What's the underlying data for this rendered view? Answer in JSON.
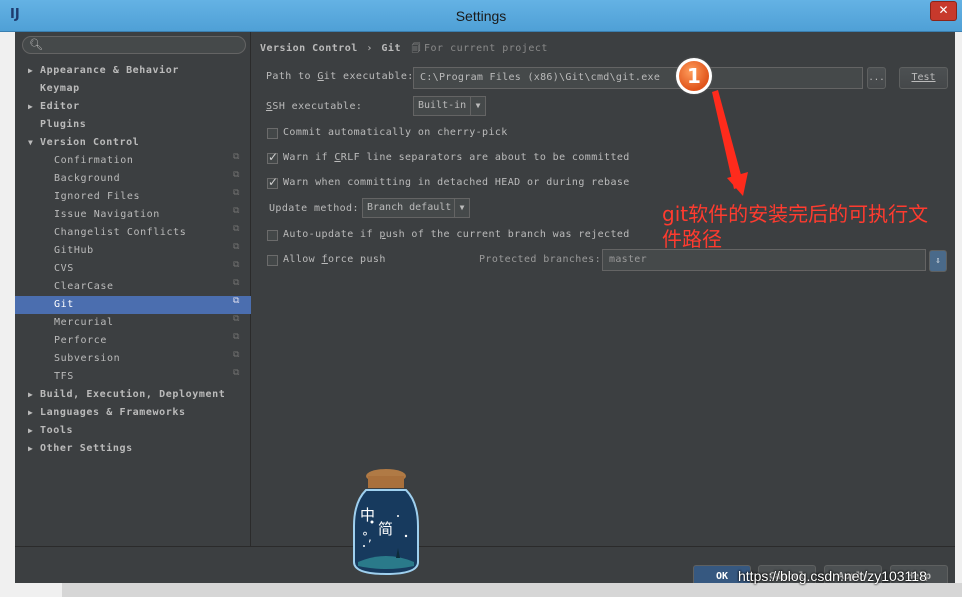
{
  "window": {
    "title": "Settings",
    "app_icon": "IJ",
    "close_label": "✕"
  },
  "search": {
    "placeholder": ""
  },
  "tree": [
    {
      "label": "Appearance & Behavior",
      "expander": "▶",
      "level": 0
    },
    {
      "label": "Keymap",
      "expander": "",
      "level": 0
    },
    {
      "label": "Editor",
      "expander": "▶",
      "level": 0
    },
    {
      "label": "Plugins",
      "expander": "",
      "level": 0
    },
    {
      "label": "Version Control",
      "expander": "▼",
      "level": 0
    },
    {
      "label": "Confirmation",
      "level": 1
    },
    {
      "label": "Background",
      "level": 1
    },
    {
      "label": "Ignored Files",
      "level": 1
    },
    {
      "label": "Issue Navigation",
      "level": 1
    },
    {
      "label": "Changelist Conflicts",
      "level": 1
    },
    {
      "label": "GitHub",
      "level": 1
    },
    {
      "label": "CVS",
      "level": 1
    },
    {
      "label": "ClearCase",
      "level": 1
    },
    {
      "label": "Git",
      "level": 1,
      "selected": true
    },
    {
      "label": "Mercurial",
      "level": 1
    },
    {
      "label": "Perforce",
      "level": 1
    },
    {
      "label": "Subversion",
      "level": 1
    },
    {
      "label": "TFS",
      "level": 1
    },
    {
      "label": "Build, Execution, Deployment",
      "expander": "▶",
      "level": 0
    },
    {
      "label": "Languages & Frameworks",
      "expander": "▶",
      "level": 0
    },
    {
      "label": "Tools",
      "expander": "▶",
      "level": 0
    },
    {
      "label": "Other Settings",
      "expander": "▶",
      "level": 0
    }
  ],
  "breadcrumb": {
    "parent": "Version Control",
    "separator": "›",
    "current": "Git",
    "scope": "For current project"
  },
  "git": {
    "path_label_pre": "Path to ",
    "path_label_u": "G",
    "path_label_post": "it executable:",
    "path_value": "C:\\Program Files (x86)\\Git\\cmd\\git.exe",
    "browse_label": "...",
    "test_label": "Test",
    "ssh_label_u": "S",
    "ssh_label_post": "SH executable:",
    "ssh_value": "Built-in",
    "commit_cherry_label": "Commit automatically on cherry-pick",
    "commit_cherry_checked": false,
    "crlf_label_pre": "Warn if ",
    "crlf_label_u": "C",
    "crlf_label_post": "RLF line separators are about to be committed",
    "crlf_checked": true,
    "detached_label": "Warn when committing in detached HEAD or during rebase",
    "detached_checked": true,
    "update_method_label": "Update method:",
    "update_method_value": "Branch default",
    "autoupdate_label_pre": "Auto-update if ",
    "autoupdate_label_u": "p",
    "autoupdate_label_post": "ush of the current branch was rejected",
    "autoupdate_checked": false,
    "force_push_label_pre": "Allow ",
    "force_push_label_u": "f",
    "force_push_label_post": "orce push",
    "force_push_checked": false,
    "protected_label": "Protected branches:",
    "protected_value": "master"
  },
  "buttons": {
    "ok": "OK",
    "cancel": "Cancel",
    "apply": "Apply",
    "help": "Help"
  },
  "annotation": {
    "badge": "1",
    "text": "git软件的安装完后的可执行文件路径",
    "color": "#ff3b2f"
  },
  "overlay": {
    "jar_char1": "中",
    "jar_char2": "简",
    "jar_char3": "°,"
  },
  "watermark": "https://blog.csdn.net/zy103118"
}
